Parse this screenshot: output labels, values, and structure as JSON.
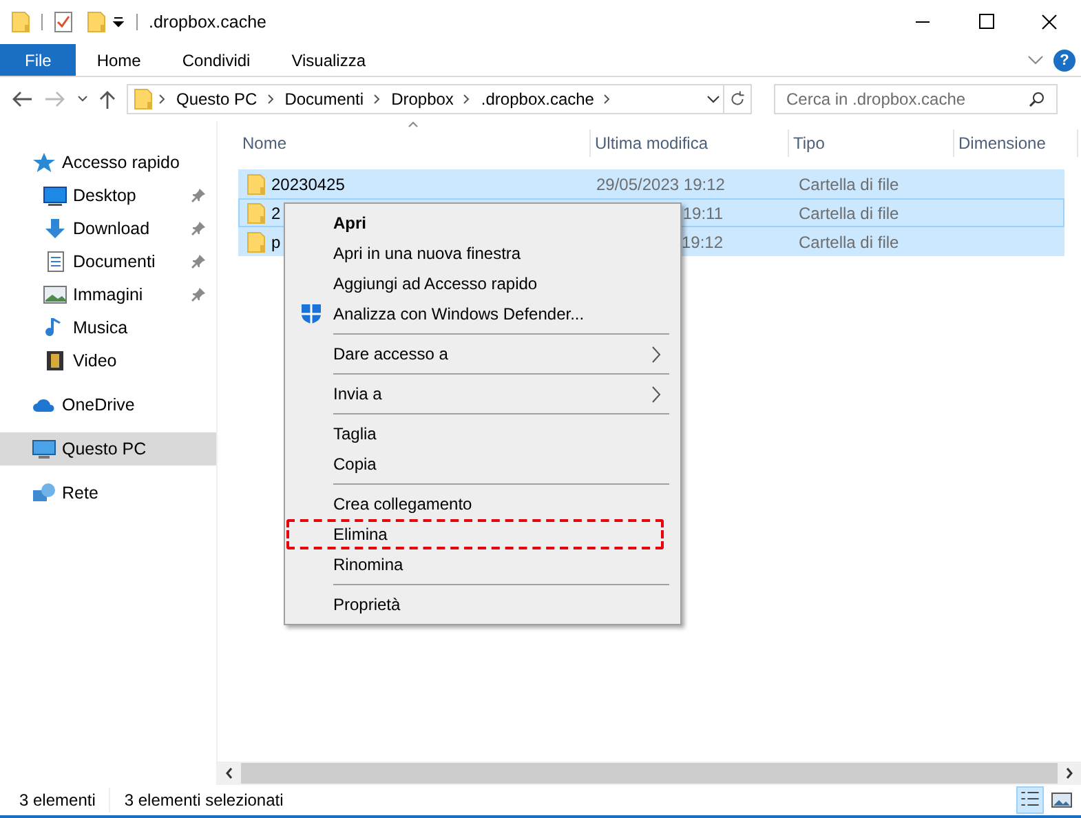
{
  "window": {
    "title": ".dropbox.cache"
  },
  "ribbon": {
    "tabs": [
      {
        "label": "File",
        "selected": true
      },
      {
        "label": "Home",
        "selected": false
      },
      {
        "label": "Condividi",
        "selected": false
      },
      {
        "label": "Visualizza",
        "selected": false
      }
    ],
    "help": "?"
  },
  "address_bar": {
    "path": [
      "Questo PC",
      "Documenti",
      "Dropbox",
      ".dropbox.cache"
    ]
  },
  "search": {
    "placeholder": "Cerca in .dropbox.cache"
  },
  "sidebar": {
    "items": [
      {
        "label": "Accesso rapido",
        "kind": "star",
        "selected": false,
        "children": [
          {
            "label": "Desktop",
            "kind": "desktop",
            "pinned": true
          },
          {
            "label": "Download",
            "kind": "download",
            "pinned": true
          },
          {
            "label": "Documenti",
            "kind": "document",
            "pinned": true
          },
          {
            "label": "Immagini",
            "kind": "image",
            "pinned": true
          },
          {
            "label": "Musica",
            "kind": "music",
            "pinned": false
          },
          {
            "label": "Video",
            "kind": "video",
            "pinned": false
          }
        ]
      },
      {
        "label": "OneDrive",
        "kind": "cloud",
        "selected": false
      },
      {
        "label": "Questo PC",
        "kind": "pc",
        "selected": true
      },
      {
        "label": "Rete",
        "kind": "network",
        "selected": false
      }
    ]
  },
  "table": {
    "columns": [
      "Nome",
      "Ultima modifica",
      "Tipo",
      "Dimensione"
    ],
    "rows": [
      {
        "name": "20230425",
        "modified": "29/05/2023 19:12",
        "type": "Cartella di file",
        "selected": true,
        "focused": false
      },
      {
        "name": "2",
        "modified": "19:11",
        "type": "Cartella di file",
        "selected": true,
        "focused": true
      },
      {
        "name": "p",
        "modified": "19:12",
        "type": "Cartella di file",
        "selected": true,
        "focused": false
      }
    ]
  },
  "context_menu": {
    "groups": [
      [
        {
          "label": "Apri",
          "kind": "plain",
          "default": true,
          "submenu": false,
          "highlighted": false
        },
        {
          "label": "Apri in una nuova finestra",
          "kind": "plain",
          "default": false,
          "submenu": false,
          "highlighted": false
        },
        {
          "label": "Aggiungi ad Accesso rapido",
          "kind": "plain",
          "default": false,
          "submenu": false,
          "highlighted": false
        },
        {
          "label": "Analizza con Windows Defender...",
          "kind": "shield",
          "default": false,
          "submenu": false,
          "highlighted": false
        }
      ],
      [
        {
          "label": "Dare accesso a",
          "kind": "plain",
          "default": false,
          "submenu": true,
          "highlighted": false
        }
      ],
      [
        {
          "label": "Invia a",
          "kind": "plain",
          "default": false,
          "submenu": true,
          "highlighted": false
        }
      ],
      [
        {
          "label": "Taglia",
          "kind": "plain",
          "default": false,
          "submenu": false,
          "highlighted": false
        },
        {
          "label": "Copia",
          "kind": "plain",
          "default": false,
          "submenu": false,
          "highlighted": false
        }
      ],
      [
        {
          "label": "Crea collegamento",
          "kind": "plain",
          "default": false,
          "submenu": false,
          "highlighted": false
        },
        {
          "label": "Elimina",
          "kind": "plain",
          "default": false,
          "submenu": false,
          "highlighted": true
        },
        {
          "label": "Rinomina",
          "kind": "plain",
          "default": false,
          "submenu": false,
          "highlighted": false
        }
      ],
      [
        {
          "label": "Proprietà",
          "kind": "plain",
          "default": false,
          "submenu": false,
          "highlighted": false
        }
      ]
    ]
  },
  "status_bar": {
    "count": "3 elementi",
    "selection": "3 elementi selezionati"
  }
}
